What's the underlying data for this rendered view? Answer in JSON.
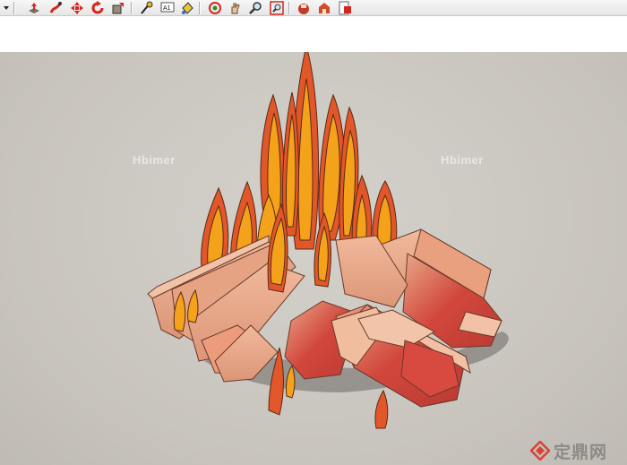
{
  "toolbar": {
    "tools": [
      {
        "name": "dropdown-arrow-icon"
      },
      {
        "name": "push-pull-icon"
      },
      {
        "name": "follow-me-icon"
      },
      {
        "name": "move-icon"
      },
      {
        "name": "rotate-icon"
      },
      {
        "name": "scale-icon"
      },
      {
        "name": "tape-measure-icon"
      },
      {
        "name": "text-tool-icon"
      },
      {
        "name": "paint-bucket-icon"
      },
      {
        "name": "orbit-icon"
      },
      {
        "name": "pan-icon"
      },
      {
        "name": "zoom-icon"
      },
      {
        "name": "zoom-extents-icon"
      },
      {
        "name": "component-icon"
      },
      {
        "name": "warehouse-icon"
      },
      {
        "name": "share-model-icon"
      }
    ],
    "text_tool_label": "A1"
  },
  "viewport": {
    "background": "#cbc8c2",
    "watermarks": [
      "Hbimer",
      "Hbimer"
    ],
    "brand_watermark": "定鼎网"
  },
  "colors": {
    "flame_outer": "#e2572a",
    "flame_inner": "#f3a21a",
    "log_light": "#e9a98b",
    "log_red": "#d8473d",
    "shadow": "#8d8a85"
  }
}
